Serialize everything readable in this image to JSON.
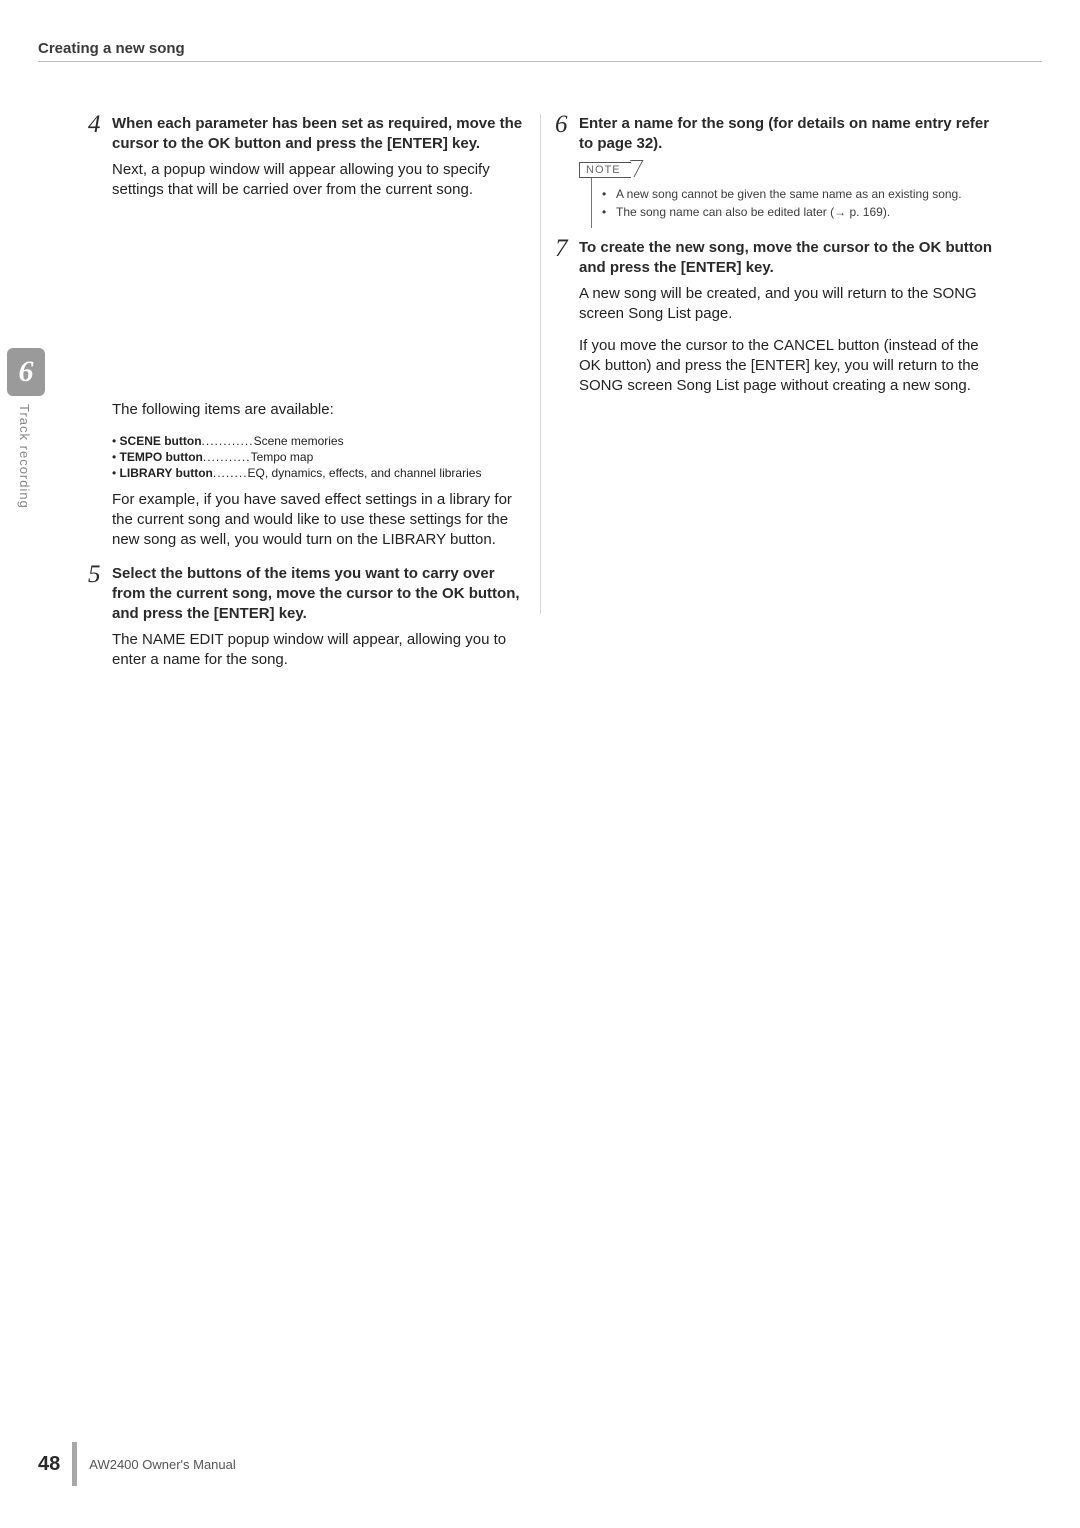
{
  "header": {
    "title": "Creating a new song"
  },
  "sidebar": {
    "chapter_num": "6",
    "chapter_label": "Track recording"
  },
  "left": {
    "step4": {
      "num": "4",
      "head": "When each parameter has been set as required, move the cursor to the OK button and press the [ENTER] key.",
      "body": "Next, a popup window will appear allowing you to specify settings that will be carried over from the current song."
    },
    "items_intro": "The following items are available:",
    "items": [
      {
        "label": "SCENE button",
        "dots": "............",
        "desc": "Scene memories"
      },
      {
        "label": "TEMPO button",
        "dots": "...........",
        "desc": "Tempo map"
      },
      {
        "label": "LIBRARY button",
        "dots": "........",
        "desc": "EQ, dynamics, effects, and channel libraries"
      }
    ],
    "lib_para": "For example, if you have saved effect settings in a library for the current song and would like to use these settings for the new song as well, you would turn on the LIBRARY button.",
    "step5": {
      "num": "5",
      "head": "Select the buttons of the items you want to carry over from the current song, move the cursor to the OK button, and press the [ENTER] key.",
      "body": "The NAME EDIT popup window will appear, allowing you to enter a name for the song."
    }
  },
  "right": {
    "step6": {
      "num": "6",
      "head": "Enter a name for the song (for details on name entry refer to page 32)."
    },
    "note_label": "NOTE",
    "notes": [
      " A new song cannot be given the same name as an existing song.",
      " The song name can also be edited later (→ p. 169)."
    ],
    "step7": {
      "num": "7",
      "head": "To create the new song, move the cursor to the OK button and press the [ENTER] key.",
      "body1": "A new song will be created, and you will return to the SONG screen Song List page.",
      "body2": "If you move the cursor to the CANCEL button (instead of the OK button) and press the [ENTER] key, you will return to the SONG screen Song List page without creating a new song."
    }
  },
  "footer": {
    "page": "48",
    "manual": "AW2400  Owner's Manual"
  }
}
